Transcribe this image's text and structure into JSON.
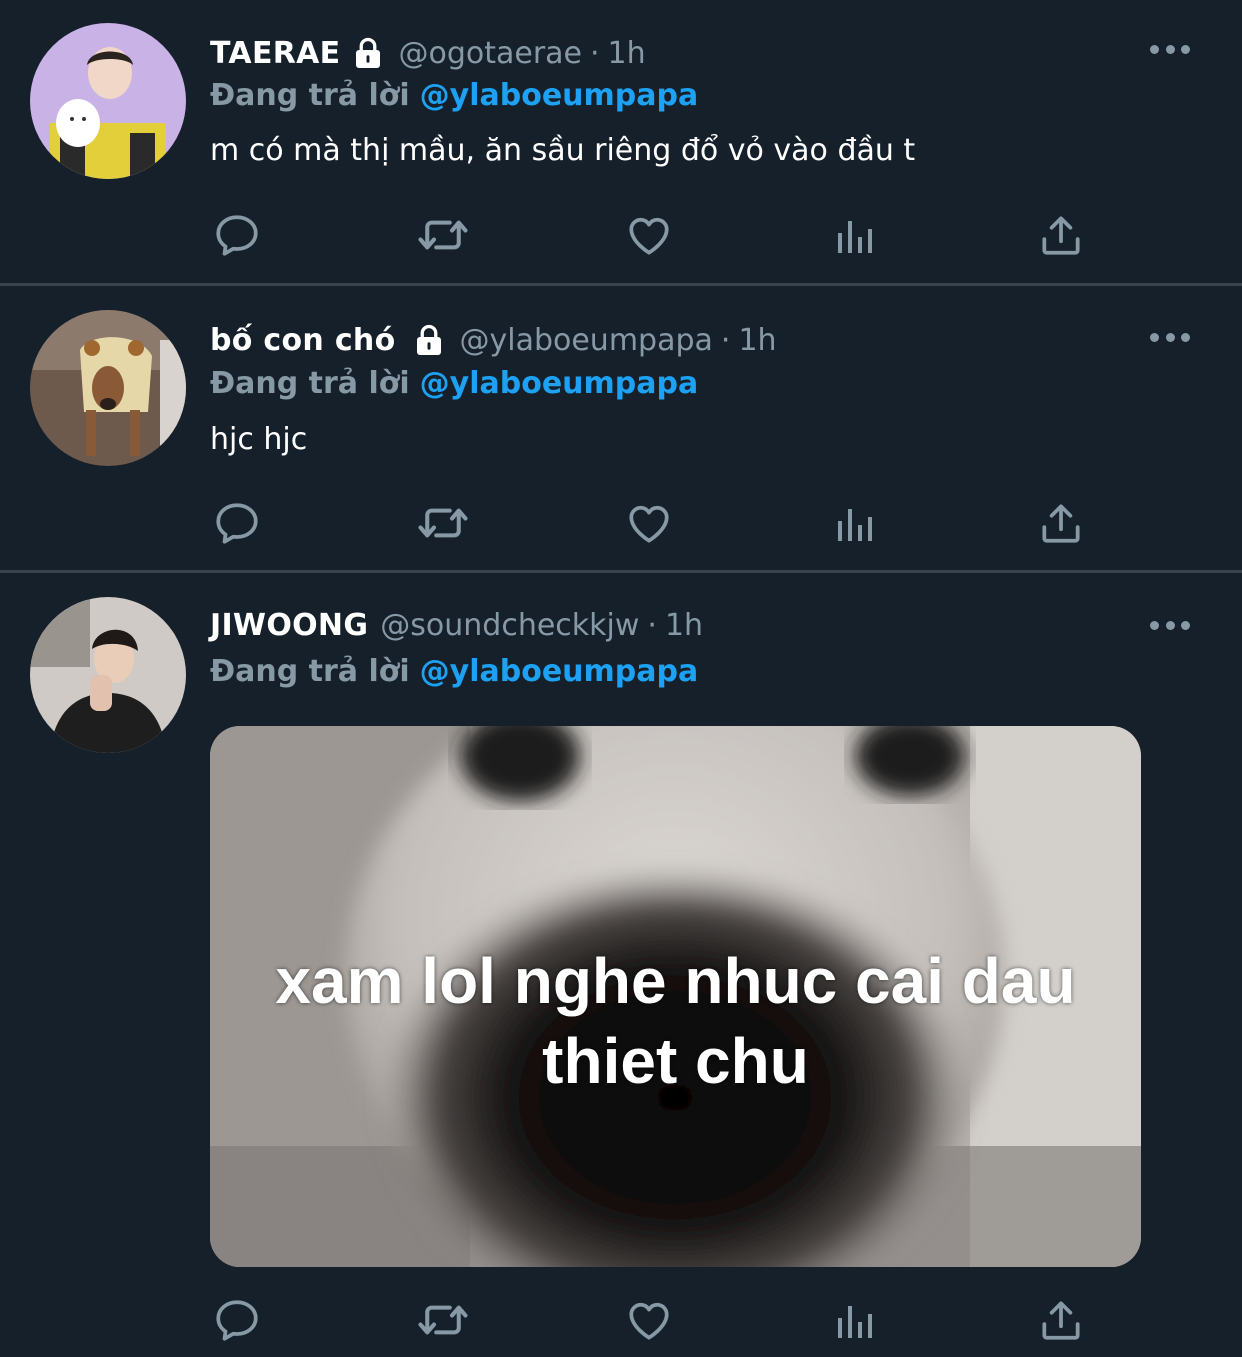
{
  "colors": {
    "background": "#15202b",
    "divider": "#38444d",
    "secondary_text": "#8899a6",
    "link": "#1da1f2",
    "primary_text": "#ffffff"
  },
  "tweets": [
    {
      "display_name": "TAERAE",
      "locked": true,
      "handle": "@ogotaerae",
      "separator": "·",
      "time": "1h",
      "reply_prefix": "Đang trả lời",
      "reply_to": "@ylaboeumpapa",
      "text": "m có mà thị mầu, ăn sầu riêng đổ vỏ vào đầu t",
      "avatar_icon": "avatar-photo-person-with-plush",
      "actions": [
        "reply-icon",
        "retweet-icon",
        "like-icon",
        "analytics-icon",
        "share-icon"
      ]
    },
    {
      "display_name": "bố con chó",
      "locked": true,
      "handle": "@ylaboeumpapa",
      "separator": "·",
      "time": "1h",
      "reply_prefix": "Đang trả lời",
      "reply_to": "@ylaboeumpapa",
      "text": "hjc hjc",
      "avatar_icon": "avatar-photo-dog-in-hoodie",
      "actions": [
        "reply-icon",
        "retweet-icon",
        "like-icon",
        "analytics-icon",
        "share-icon"
      ]
    },
    {
      "display_name": "JIWOONG",
      "locked": false,
      "handle": "@soundcheckkjw",
      "separator": "·",
      "time": "1h",
      "reply_prefix": "Đang trả lời",
      "reply_to": "@ylaboeumpapa",
      "text": "",
      "avatar_icon": "avatar-photo-person-black-shirt",
      "media": {
        "caption_line1": "xam lol nghe nhuc cai dau",
        "caption_line2": "thiet chu",
        "image_icon": "meme-image-animal-snout-closeup"
      },
      "actions": [
        "reply-icon",
        "retweet-icon",
        "like-icon",
        "analytics-icon",
        "share-icon"
      ]
    }
  ]
}
